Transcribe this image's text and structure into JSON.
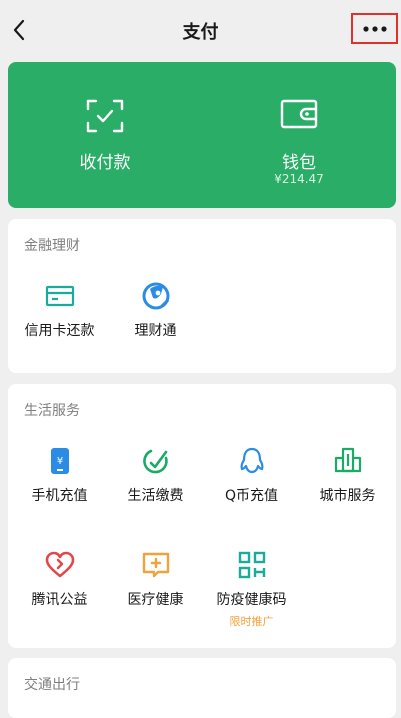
{
  "header": {
    "title": "支付"
  },
  "hero": {
    "receive": {
      "label": "收付款"
    },
    "wallet": {
      "label": "钱包",
      "balance": "¥214.47"
    }
  },
  "finance": {
    "title": "金融理财",
    "items": [
      {
        "label": "信用卡还款",
        "icon": "credit-card-icon"
      },
      {
        "label": "理财通",
        "icon": "wealth-icon"
      }
    ]
  },
  "life": {
    "title": "生活服务",
    "items": [
      {
        "label": "手机充值",
        "icon": "phone-topup-icon"
      },
      {
        "label": "生活缴费",
        "icon": "utility-icon"
      },
      {
        "label": "Q币充值",
        "icon": "qq-penguin-icon"
      },
      {
        "label": "城市服务",
        "icon": "city-building-icon"
      },
      {
        "label": "腾讯公益",
        "icon": "charity-heart-icon"
      },
      {
        "label": "医疗健康",
        "icon": "medical-plus-icon"
      },
      {
        "label": "防疫健康码",
        "icon": "qr-code-icon",
        "tag": "限时推广"
      }
    ]
  },
  "next_section": {
    "title": "交通出行"
  },
  "colors": {
    "brand_green": "#2aae67",
    "highlight_red": "#e0322d",
    "promo_orange": "#f0a23b"
  }
}
